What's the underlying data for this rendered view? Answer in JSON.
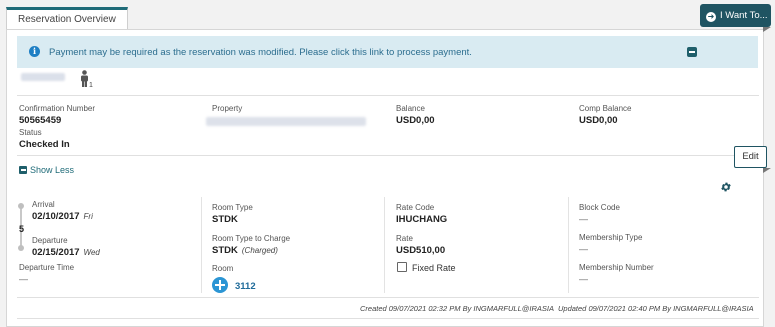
{
  "tab": {
    "label": "Reservation Overview"
  },
  "banner": {
    "message": "Payment may be required as the reservation was modified. Please click this link to process payment."
  },
  "actions": {
    "i_want_to": "I Want To...",
    "edit": "Edit",
    "show_less": "Show Less"
  },
  "guest": {
    "adults": "1"
  },
  "summary": {
    "confirmation_label": "Confirmation Number",
    "confirmation_value": "50565459",
    "status_label": "Status",
    "status_value": "Checked In",
    "property_label": "Property",
    "balance_label": "Balance",
    "balance_value": "USD0,00",
    "comp_balance_label": "Comp Balance",
    "comp_balance_value": "USD0,00"
  },
  "details": {
    "arrival_label": "Arrival",
    "arrival_date": "02/10/2017",
    "arrival_day": "Fri",
    "nights": "5",
    "departure_label": "Departure",
    "departure_date": "02/15/2017",
    "departure_day": "Wed",
    "departure_time_label": "Departure Time",
    "departure_time_value": "—",
    "room_type_label": "Room Type",
    "room_type_value": "STDK",
    "room_type_charge_label": "Room Type to Charge",
    "room_type_charge_value": "STDK",
    "room_type_charge_note": "(Charged)",
    "room_label": "Room",
    "room_value": "3112",
    "rate_code_label": "Rate Code",
    "rate_code_value": "IHUCHANG",
    "rate_label": "Rate",
    "rate_value": "USD510,00",
    "fixed_rate_label": "Fixed Rate",
    "block_code_label": "Block Code",
    "block_code_value": "—",
    "membership_type_label": "Membership Type",
    "membership_type_value": "—",
    "membership_number_label": "Membership Number",
    "membership_number_value": "—"
  },
  "footer": {
    "created": "Created 09/07/2021 02:32 PM By INGMARFULL@IRASIA",
    "updated": "Updated 09/07/2021 02:40 PM By INGMARFULL@IRASIA"
  },
  "icons": [
    "info-icon",
    "collapse-icon",
    "arrow-right-circle-icon",
    "person-icon",
    "gear-icon",
    "minus-square-icon",
    "add-room-icon"
  ],
  "colors": {
    "accent": "#1f5462",
    "banner_bg": "#d9ebf2",
    "link": "#1f6b9a"
  }
}
